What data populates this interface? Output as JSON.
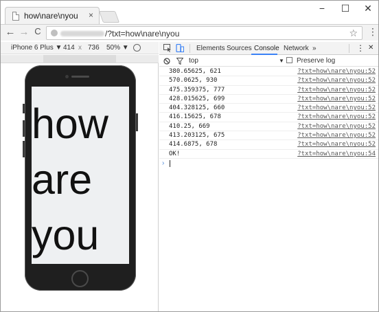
{
  "browser": {
    "tab_title": "how\\nare\\nyou",
    "tab_close": "×",
    "window_controls": {
      "minimize": "−",
      "maximize": "☐",
      "close": "✕"
    },
    "nav": {
      "back": "←",
      "forward": "→",
      "reload": "C"
    },
    "address": {
      "url_suffix": "/?txt=how\\nare\\nyou",
      "star": "☆"
    },
    "menu": "⋮"
  },
  "device_toolbar": {
    "device": "iPhone 6 Plus ▼",
    "width": "414",
    "times": "x",
    "height": "736",
    "zoom": "50% ▼"
  },
  "preview": {
    "text": "how\nare\nyou"
  },
  "devtools": {
    "tabs": [
      "Elements",
      "Sources",
      "Console",
      "Network",
      "»"
    ],
    "active_tab": "Console",
    "context": "top",
    "context_arrow": "▼",
    "preserve_log": "Preserve log",
    "menu": "⋮",
    "close": "✕"
  },
  "console": {
    "rows": [
      {
        "message": "380.65625, 621",
        "source": "?txt=how\\nare\\nyou:52"
      },
      {
        "message": "570.0625, 930",
        "source": "?txt=how\\nare\\nyou:52"
      },
      {
        "message": "475.359375, 777",
        "source": "?txt=how\\nare\\nyou:52"
      },
      {
        "message": "428.015625, 699",
        "source": "?txt=how\\nare\\nyou:52"
      },
      {
        "message": "404.328125, 660",
        "source": "?txt=how\\nare\\nyou:52"
      },
      {
        "message": "416.15625, 678",
        "source": "?txt=how\\nare\\nyou:52"
      },
      {
        "message": "410.25, 669",
        "source": "?txt=how\\nare\\nyou:52"
      },
      {
        "message": "413.203125, 675",
        "source": "?txt=how\\nare\\nyou:52"
      },
      {
        "message": "414.6875, 678",
        "source": "?txt=how\\nare\\nyou:52"
      },
      {
        "message": "OK!",
        "source": "?txt=how\\nare\\nyou:54"
      }
    ],
    "prompt": "›"
  }
}
